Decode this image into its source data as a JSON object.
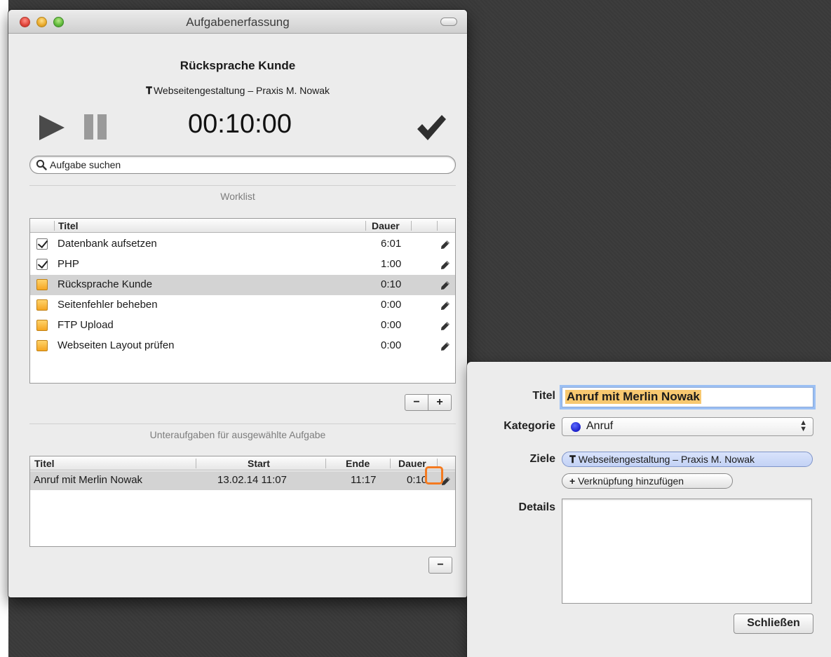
{
  "window": {
    "title": "Aufgabenerfassung"
  },
  "current_task": {
    "title": "Rücksprache Kunde",
    "project_icon": "pin-icon",
    "project": "Webseitengestaltung – Praxis M. Nowak",
    "timer": "00:10:00"
  },
  "search": {
    "placeholder": "Aufgabe suchen",
    "value": ""
  },
  "worklist": {
    "section_label": "Worklist",
    "columns": [
      "Titel",
      "Dauer"
    ],
    "rows": [
      {
        "done": true,
        "title": "Datenbank aufsetzen",
        "duration": "6:01"
      },
      {
        "done": true,
        "title": "PHP",
        "duration": "1:00"
      },
      {
        "done": false,
        "title": "Rücksprache Kunde",
        "duration": "0:10",
        "selected": true
      },
      {
        "done": false,
        "title": "Seitenfehler beheben",
        "duration": "0:00"
      },
      {
        "done": false,
        "title": "FTP Upload",
        "duration": "0:00"
      },
      {
        "done": false,
        "title": "Webseiten Layout prüfen",
        "duration": "0:00"
      }
    ],
    "remove_label": "−",
    "add_label": "+"
  },
  "subtasks": {
    "section_label": "Unteraufgaben für ausgewählte Aufgabe",
    "columns": [
      "Titel",
      "Start",
      "Ende",
      "Dauer"
    ],
    "rows": [
      {
        "title": "Anruf mit Merlin Nowak",
        "start": "13.02.14 11:07",
        "end": "11:17",
        "duration": "0:10"
      }
    ],
    "remove_label": "−"
  },
  "popover": {
    "title_label": "Titel",
    "title_value": "Anruf mit Merlin Nowak",
    "category_label": "Kategorie",
    "category_value": "Anruf",
    "category_color": "#1b1fc9",
    "goals_label": "Ziele",
    "goal_token": "Webseitengestaltung – Praxis M. Nowak",
    "add_link_label": "Verknüpfung hinzufügen",
    "details_label": "Details",
    "details_value": "",
    "close_label": "Schließen"
  },
  "colors": {
    "highlight_ring": "#f47a20",
    "todo_checkbox": "#f5a623",
    "focus_ring": "#9cc0f4"
  }
}
